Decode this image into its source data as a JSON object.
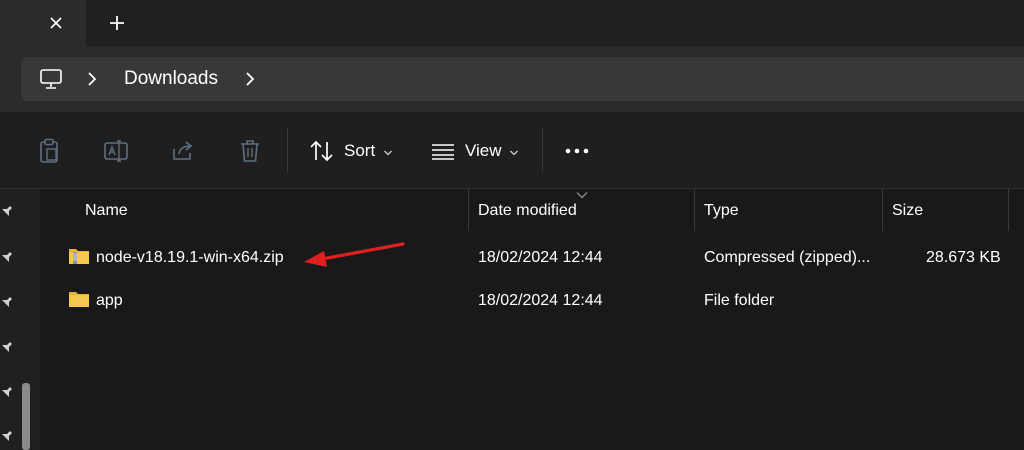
{
  "tabs": {
    "close_icon": "close-icon",
    "new_tab_icon": "plus-icon"
  },
  "address": {
    "root_icon": "this-pc-icon",
    "path": [
      "Downloads"
    ]
  },
  "commandbar": {
    "sort_label": "Sort",
    "view_label": "View"
  },
  "columns": {
    "name": "Name",
    "date": "Date modified",
    "type": "Type",
    "size": "Size"
  },
  "files": [
    {
      "name": "node-v18.19.1-win-x64.zip",
      "date": "18/02/2024 12:44",
      "type": "Compressed (zipped)...",
      "size": "28.673 KB",
      "icon": "zip-folder-icon"
    },
    {
      "name": "app",
      "date": "18/02/2024 12:44",
      "type": "File folder",
      "size": "",
      "icon": "folder-icon"
    }
  ],
  "colors": {
    "background": "#191919",
    "annotation_arrow": "#e02020",
    "folder": "#f0c040"
  }
}
